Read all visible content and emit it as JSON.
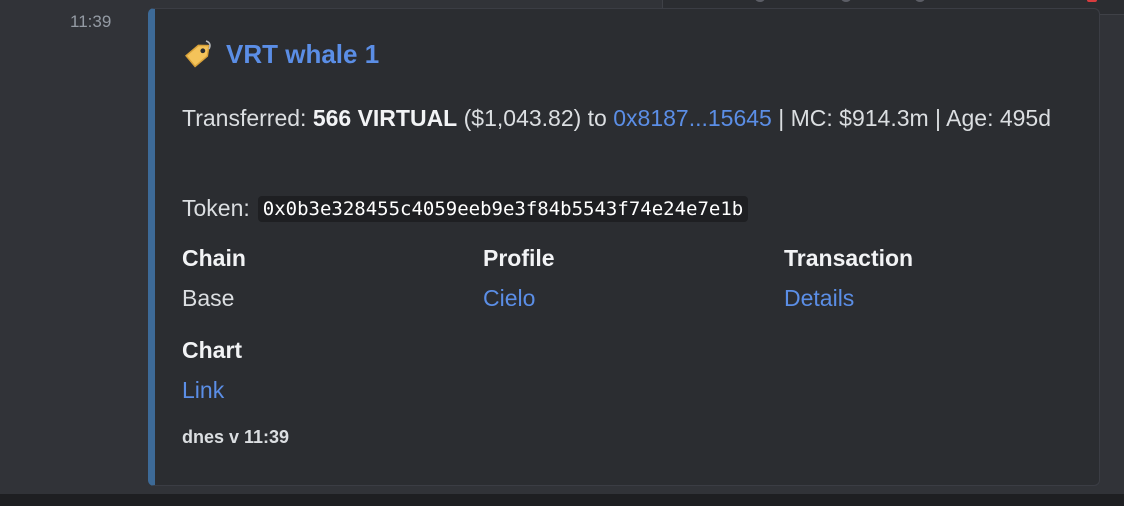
{
  "message": {
    "timestamp": "11:39"
  },
  "embed": {
    "accent_color": "#3d6a97",
    "title_icon": "tag-icon",
    "title": "VRT whale 1",
    "description": {
      "prefix": "Transferred: ",
      "amount": "566 VIRTUAL",
      "usd": " ($1,043.82) to ",
      "address": "0x8187...15645",
      "suffix": " | MC: $914.3m | Age: 495d"
    },
    "token": {
      "label": "Token:",
      "address": "0x0b3e328455c4059eeb9e3f84b5543f74e24e7e1b"
    },
    "fields": [
      {
        "name": "Chain",
        "value": "Base",
        "is_link": false
      },
      {
        "name": "Profile",
        "value": "Cielo",
        "is_link": true
      },
      {
        "name": "Transaction",
        "value": "Details",
        "is_link": true
      },
      {
        "name": "Chart",
        "value": "Link",
        "is_link": true
      }
    ],
    "footer": "dnes v 11:39"
  },
  "colors": {
    "background": "#313338",
    "embed_background": "#2b2d31",
    "link": "#5b8ee6"
  }
}
